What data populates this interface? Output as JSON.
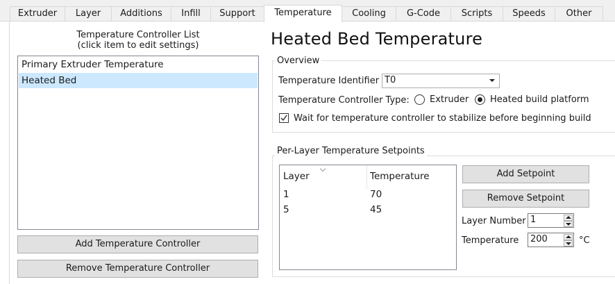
{
  "tabs": [
    {
      "label": "Extruder"
    },
    {
      "label": "Layer"
    },
    {
      "label": "Additions"
    },
    {
      "label": "Infill"
    },
    {
      "label": "Support"
    },
    {
      "label": "Temperature",
      "active": true
    },
    {
      "label": "Cooling"
    },
    {
      "label": "G-Code"
    },
    {
      "label": "Scripts"
    },
    {
      "label": "Speeds"
    },
    {
      "label": "Other"
    }
  ],
  "controller_list": {
    "caption_line1": "Temperature Controller List",
    "caption_line2": "(click item to edit settings)",
    "items": [
      {
        "label": "Primary Extruder Temperature",
        "selected": false
      },
      {
        "label": "Heated Bed",
        "selected": true
      }
    ],
    "add_button": "Add Temperature Controller",
    "remove_button": "Remove Temperature Controller"
  },
  "heading": "Heated Bed Temperature",
  "overview": {
    "title": "Overview",
    "identifier_label": "Temperature Identifier",
    "identifier_value": "T0",
    "type_label": "Temperature Controller Type:",
    "type_options": [
      {
        "label": "Extruder",
        "checked": false
      },
      {
        "label": "Heated build platform",
        "checked": true
      }
    ],
    "wait_checkbox_label": "Wait for temperature controller to stabilize before beginning build",
    "wait_checked": true
  },
  "setpoints": {
    "title": "Per-Layer Temperature Setpoints",
    "columns": [
      "Layer",
      "Temperature"
    ],
    "rows": [
      [
        "1",
        "70"
      ],
      [
        "5",
        "45"
      ]
    ],
    "add_button": "Add Setpoint",
    "remove_button": "Remove Setpoint",
    "layer_number_label": "Layer Number",
    "layer_number_value": "1",
    "temperature_label": "Temperature",
    "temperature_value": "200",
    "temperature_unit": "°C"
  },
  "colors": {
    "selection": "#cce8ff",
    "button_face": "#e1e1e1",
    "tab_strip": "#f0f0f0"
  }
}
